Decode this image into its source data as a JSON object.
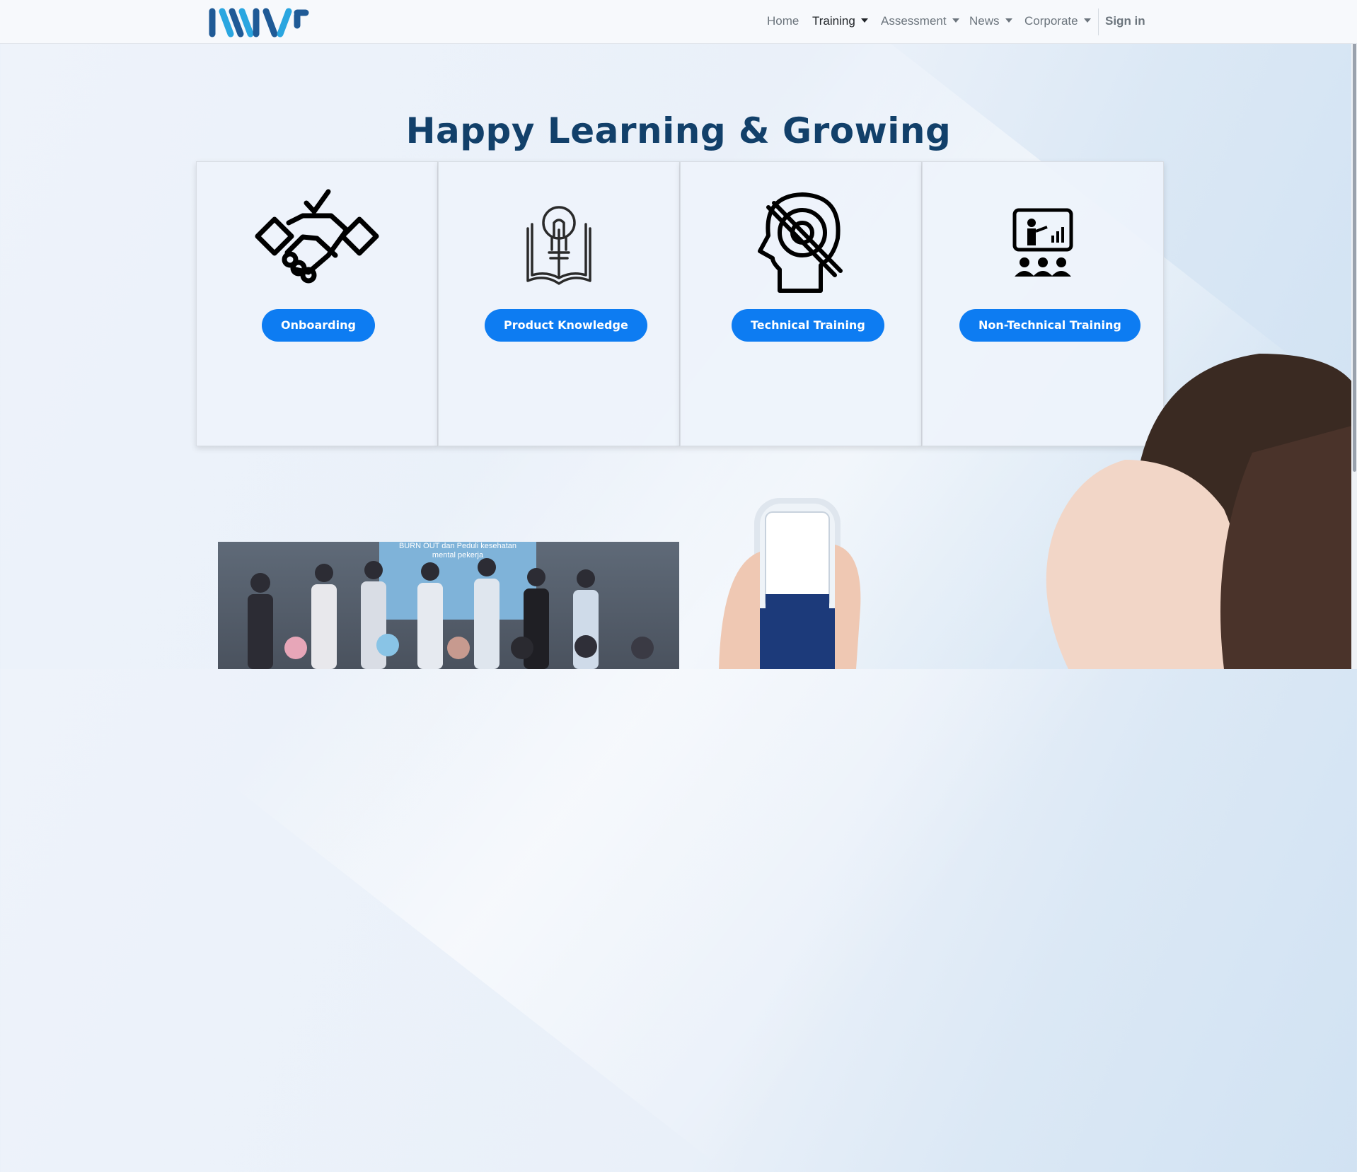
{
  "nav": {
    "items": [
      {
        "label": "Home"
      },
      {
        "label": "Training"
      },
      {
        "label": "Assessment"
      },
      {
        "label": "News"
      },
      {
        "label": "Corporate"
      }
    ],
    "sign_in": "Sign in"
  },
  "hero": {
    "title": "Happy Learning & Growing"
  },
  "cards": [
    {
      "label": "Onboarding",
      "icon": "handshake-icon"
    },
    {
      "label": "Product Knowledge",
      "icon": "lightbulb-book-icon"
    },
    {
      "label": "Technical Training",
      "icon": "head-gear-icon"
    },
    {
      "label": "Non-Technical Training",
      "icon": "presentation-icon"
    }
  ],
  "photo": {
    "caption_line1": "BURN OUT dan Peduli kesehatan",
    "caption_line2": "mental pekerja"
  },
  "colors": {
    "accent": "#0d7cf2",
    "headline": "#12406a",
    "logo_dark": "#1f5a96",
    "logo_light": "#2aa6e0"
  }
}
